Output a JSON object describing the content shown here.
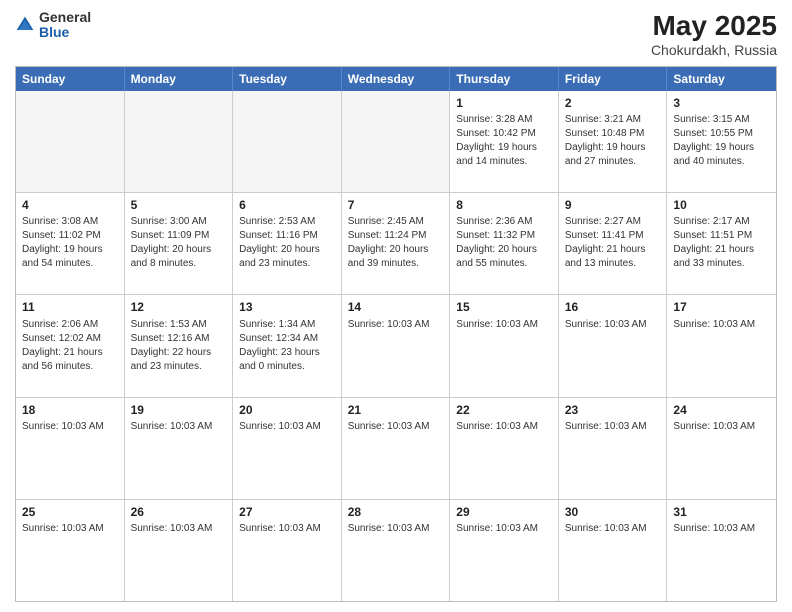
{
  "logo": {
    "general": "General",
    "blue": "Blue"
  },
  "title": "May 2025",
  "location": "Chokurdakh, Russia",
  "header_days": [
    "Sunday",
    "Monday",
    "Tuesday",
    "Wednesday",
    "Thursday",
    "Friday",
    "Saturday"
  ],
  "rows": [
    [
      {
        "day": "",
        "info": "",
        "empty": true
      },
      {
        "day": "",
        "info": "",
        "empty": true
      },
      {
        "day": "",
        "info": "",
        "empty": true
      },
      {
        "day": "",
        "info": "",
        "empty": true
      },
      {
        "day": "1",
        "info": "Sunrise: 3:28 AM\nSunset: 10:42 PM\nDaylight: 19 hours\nand 14 minutes."
      },
      {
        "day": "2",
        "info": "Sunrise: 3:21 AM\nSunset: 10:48 PM\nDaylight: 19 hours\nand 27 minutes."
      },
      {
        "day": "3",
        "info": "Sunrise: 3:15 AM\nSunset: 10:55 PM\nDaylight: 19 hours\nand 40 minutes."
      }
    ],
    [
      {
        "day": "4",
        "info": "Sunrise: 3:08 AM\nSunset: 11:02 PM\nDaylight: 19 hours\nand 54 minutes."
      },
      {
        "day": "5",
        "info": "Sunrise: 3:00 AM\nSunset: 11:09 PM\nDaylight: 20 hours\nand 8 minutes."
      },
      {
        "day": "6",
        "info": "Sunrise: 2:53 AM\nSunset: 11:16 PM\nDaylight: 20 hours\nand 23 minutes."
      },
      {
        "day": "7",
        "info": "Sunrise: 2:45 AM\nSunset: 11:24 PM\nDaylight: 20 hours\nand 39 minutes."
      },
      {
        "day": "8",
        "info": "Sunrise: 2:36 AM\nSunset: 11:32 PM\nDaylight: 20 hours\nand 55 minutes."
      },
      {
        "day": "9",
        "info": "Sunrise: 2:27 AM\nSunset: 11:41 PM\nDaylight: 21 hours\nand 13 minutes."
      },
      {
        "day": "10",
        "info": "Sunrise: 2:17 AM\nSunset: 11:51 PM\nDaylight: 21 hours\nand 33 minutes."
      }
    ],
    [
      {
        "day": "11",
        "info": "Sunrise: 2:06 AM\nSunset: 12:02 AM\nDaylight: 21 hours\nand 56 minutes."
      },
      {
        "day": "12",
        "info": "Sunrise: 1:53 AM\nSunset: 12:16 AM\nDaylight: 22 hours\nand 23 minutes."
      },
      {
        "day": "13",
        "info": "Sunrise: 1:34 AM\nSunset: 12:34 AM\nDaylight: 23 hours\nand 0 minutes."
      },
      {
        "day": "14",
        "info": "Sunrise: 10:03 AM"
      },
      {
        "day": "15",
        "info": "Sunrise: 10:03 AM"
      },
      {
        "day": "16",
        "info": "Sunrise: 10:03 AM"
      },
      {
        "day": "17",
        "info": "Sunrise: 10:03 AM"
      }
    ],
    [
      {
        "day": "18",
        "info": "Sunrise: 10:03 AM"
      },
      {
        "day": "19",
        "info": "Sunrise: 10:03 AM"
      },
      {
        "day": "20",
        "info": "Sunrise: 10:03 AM"
      },
      {
        "day": "21",
        "info": "Sunrise: 10:03 AM"
      },
      {
        "day": "22",
        "info": "Sunrise: 10:03 AM"
      },
      {
        "day": "23",
        "info": "Sunrise: 10:03 AM"
      },
      {
        "day": "24",
        "info": "Sunrise: 10:03 AM"
      }
    ],
    [
      {
        "day": "25",
        "info": "Sunrise: 10:03 AM"
      },
      {
        "day": "26",
        "info": "Sunrise: 10:03 AM"
      },
      {
        "day": "27",
        "info": "Sunrise: 10:03 AM"
      },
      {
        "day": "28",
        "info": "Sunrise: 10:03 AM"
      },
      {
        "day": "29",
        "info": "Sunrise: 10:03 AM"
      },
      {
        "day": "30",
        "info": "Sunrise: 10:03 AM"
      },
      {
        "day": "31",
        "info": "Sunrise: 10:03 AM"
      }
    ]
  ]
}
